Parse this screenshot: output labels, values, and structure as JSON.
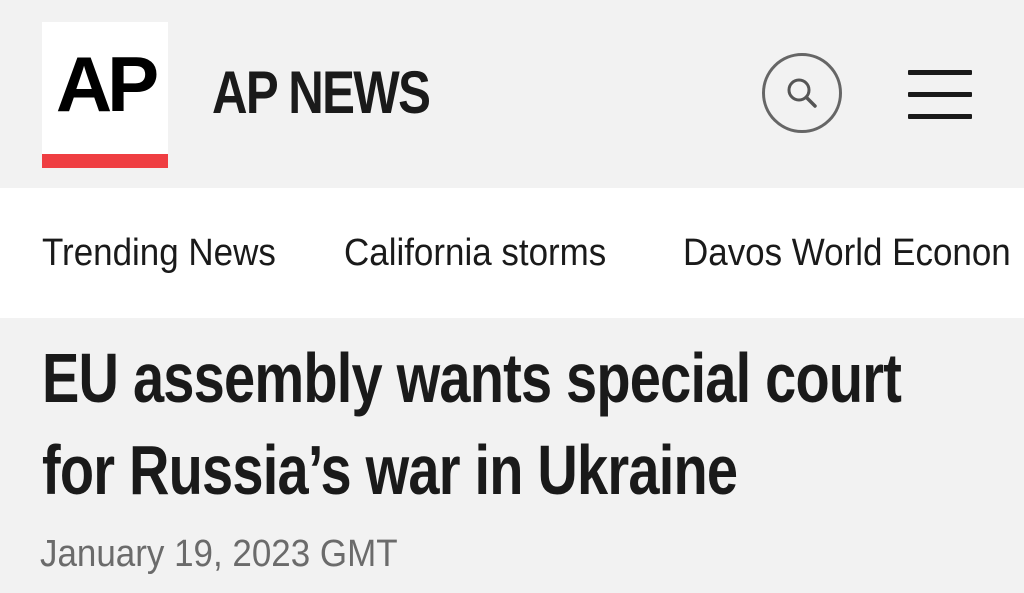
{
  "header": {
    "logo_text": "AP",
    "brand_title": "AP NEWS",
    "accent_color": "#ef3e42",
    "search_icon": "search-icon",
    "menu_icon": "hamburger-menu-icon"
  },
  "nav": {
    "items": [
      {
        "label": "Trending News"
      },
      {
        "label": "California storms"
      },
      {
        "label": "Davos World Econon"
      }
    ]
  },
  "article": {
    "headline_line1": "EU assembly wants special court",
    "headline_line2": "for Russia’s war in Ukraine",
    "date": "January 19, 2023 GMT"
  }
}
